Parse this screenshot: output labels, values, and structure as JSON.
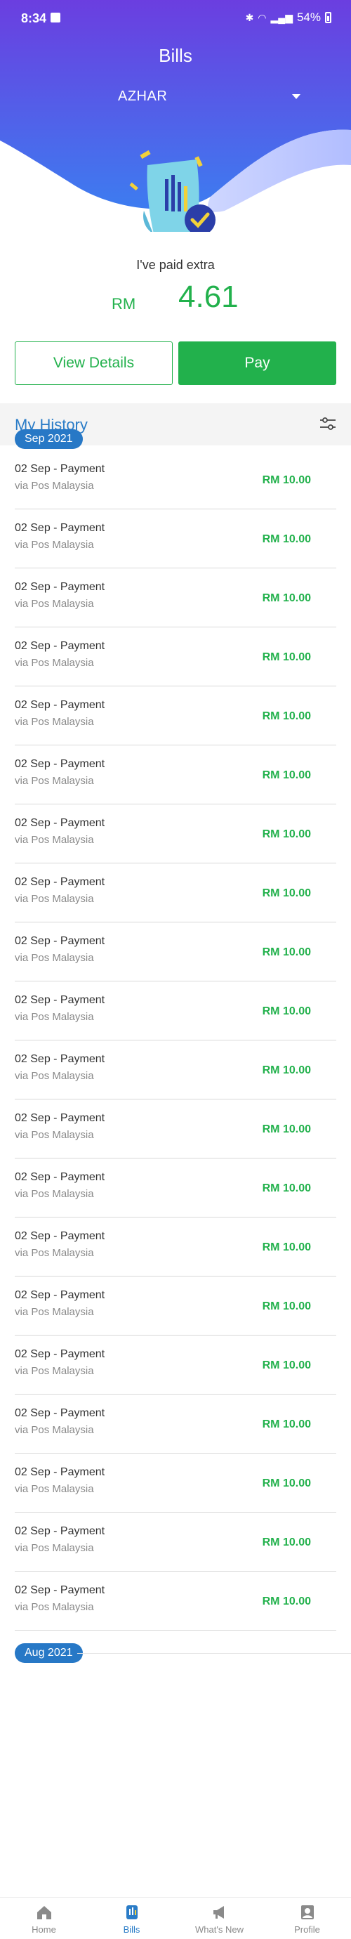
{
  "status_bar": {
    "time": "8:34",
    "battery": "54%"
  },
  "header": {
    "title": "Bills",
    "account": "AZHAR"
  },
  "summary": {
    "label": "I've paid extra",
    "currency": "RM",
    "amount": "4.61"
  },
  "actions": {
    "view_details": "View Details",
    "pay": "Pay"
  },
  "history": {
    "title": "My History",
    "months": [
      "Sep 2021",
      "Aug 2021"
    ],
    "transactions": [
      {
        "title": "02 Sep - Payment",
        "channel": "via Pos Malaysia",
        "amount": "RM 10.00"
      },
      {
        "title": "02 Sep - Payment",
        "channel": "via Pos Malaysia",
        "amount": "RM 10.00"
      },
      {
        "title": "02 Sep - Payment",
        "channel": "via Pos Malaysia",
        "amount": "RM 10.00"
      },
      {
        "title": "02 Sep - Payment",
        "channel": "via Pos Malaysia",
        "amount": "RM 10.00"
      },
      {
        "title": "02 Sep - Payment",
        "channel": "via Pos Malaysia",
        "amount": "RM 10.00"
      },
      {
        "title": "02 Sep - Payment",
        "channel": "via Pos Malaysia",
        "amount": "RM 10.00"
      },
      {
        "title": "02 Sep - Payment",
        "channel": "via Pos Malaysia",
        "amount": "RM 10.00"
      },
      {
        "title": "02 Sep - Payment",
        "channel": "via Pos Malaysia",
        "amount": "RM 10.00"
      },
      {
        "title": "02 Sep - Payment",
        "channel": "via Pos Malaysia",
        "amount": "RM 10.00"
      },
      {
        "title": "02 Sep - Payment",
        "channel": "via Pos Malaysia",
        "amount": "RM 10.00"
      },
      {
        "title": "02 Sep - Payment",
        "channel": "via Pos Malaysia",
        "amount": "RM 10.00"
      },
      {
        "title": "02 Sep - Payment",
        "channel": "via Pos Malaysia",
        "amount": "RM 10.00"
      },
      {
        "title": "02 Sep - Payment",
        "channel": "via Pos Malaysia",
        "amount": "RM 10.00"
      },
      {
        "title": "02 Sep - Payment",
        "channel": "via Pos Malaysia",
        "amount": "RM 10.00"
      },
      {
        "title": "02 Sep - Payment",
        "channel": "via Pos Malaysia",
        "amount": "RM 10.00"
      },
      {
        "title": "02 Sep - Payment",
        "channel": "via Pos Malaysia",
        "amount": "RM 10.00"
      },
      {
        "title": "02 Sep - Payment",
        "channel": "via Pos Malaysia",
        "amount": "RM 10.00"
      },
      {
        "title": "02 Sep - Payment",
        "channel": "via Pos Malaysia",
        "amount": "RM 10.00"
      },
      {
        "title": "02 Sep - Payment",
        "channel": "via Pos Malaysia",
        "amount": "RM 10.00"
      },
      {
        "title": "02 Sep - Payment",
        "channel": "via Pos Malaysia",
        "amount": "RM 10.00"
      }
    ]
  },
  "nav": [
    {
      "label": "Home",
      "icon": "home-icon"
    },
    {
      "label": "Bills",
      "icon": "bills-icon"
    },
    {
      "label": "What's New",
      "icon": "megaphone-icon"
    },
    {
      "label": "Profile",
      "icon": "profile-icon"
    }
  ],
  "colors": {
    "primary_blue": "#2a7cc7",
    "green": "#22b14c",
    "hero_purple": "#6a3fe0"
  }
}
